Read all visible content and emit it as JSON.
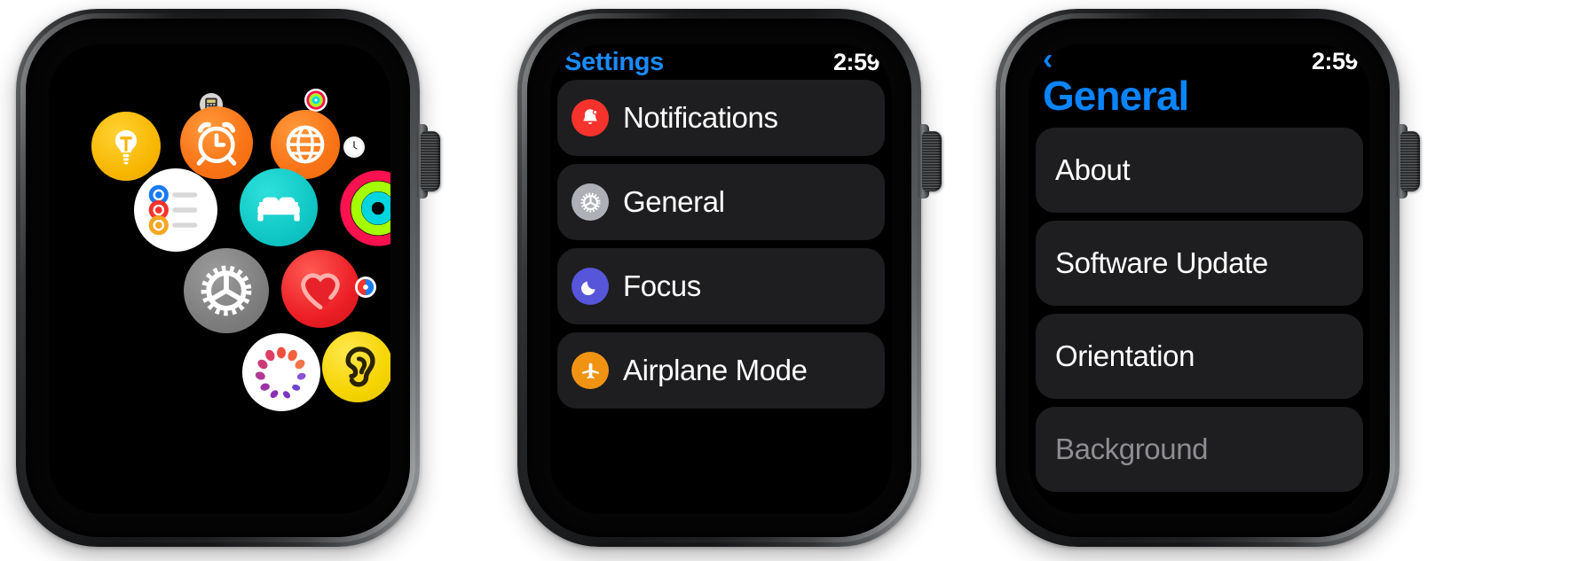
{
  "watches": [
    {
      "name": "app-grid-watch",
      "screen": "home-app-grid",
      "apps": [
        {
          "name": "calculator",
          "label": "Calculator"
        },
        {
          "name": "activity-small",
          "label": "Activity"
        },
        {
          "name": "tips",
          "label": "Tips"
        },
        {
          "name": "alarms",
          "label": "Alarms"
        },
        {
          "name": "world-clock",
          "label": "World Clock"
        },
        {
          "name": "clock-small",
          "label": "Clock"
        },
        {
          "name": "reminders",
          "label": "Reminders"
        },
        {
          "name": "sleep",
          "label": "Sleep"
        },
        {
          "name": "activity",
          "label": "Activity"
        },
        {
          "name": "settings",
          "label": "Settings"
        },
        {
          "name": "heart-rate",
          "label": "Heart Rate"
        },
        {
          "name": "music-small",
          "label": "Music"
        },
        {
          "name": "mindfulness",
          "label": "Mindfulness"
        },
        {
          "name": "noise",
          "label": "Noise"
        }
      ]
    },
    {
      "name": "settings-watch",
      "screen": "settings-list",
      "title": "Settings",
      "time": "2:59",
      "rows": [
        {
          "label": "Notifications",
          "icon": "bell-icon",
          "color": "#f6322c"
        },
        {
          "label": "General",
          "icon": "gear-icon",
          "color": "#aeb0b8"
        },
        {
          "label": "Focus",
          "icon": "moon-icon",
          "color": "#5755d9"
        },
        {
          "label": "Airplane Mode",
          "icon": "airplane-icon",
          "color": "#f09313"
        }
      ]
    },
    {
      "name": "general-watch",
      "screen": "general-list",
      "back": "‹",
      "title": "General",
      "time": "2:59",
      "rows": [
        {
          "label": "About"
        },
        {
          "label": "Software Update"
        },
        {
          "label": "Orientation"
        },
        {
          "label": "Background"
        }
      ]
    }
  ],
  "colors": {
    "accent_blue": "#0a84ff",
    "row_bg": "#1e1e20",
    "screen_bg": "#000000",
    "text_primary": "#ffffff",
    "text_dim": "#8d8d92"
  }
}
